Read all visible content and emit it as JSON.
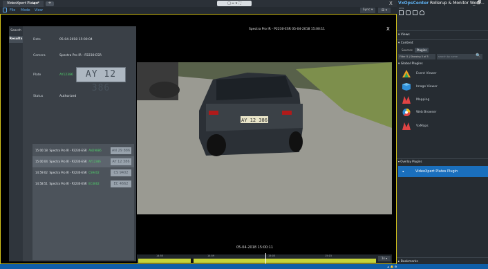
{
  "window": {
    "tab_label": "VideoXpert Plates*",
    "tab_close": "◀ x",
    "tab_add": "+",
    "center_controls": "□ ━ ∨ ⛶",
    "close": "X"
  },
  "menu": {
    "items": [
      "File",
      "Mode",
      "View"
    ],
    "sync_label": "Sync ▾",
    "layout_label": "⊞ ▾"
  },
  "left_tabs": {
    "search": "Search",
    "results": "Results"
  },
  "details": {
    "date_label": "Date",
    "date_value": "05-04-2018 15:00:04",
    "camera_label": "Camera",
    "camera_value": "Spectra Pro IR - P2230-ESR",
    "plate_label": "Plate",
    "plate_value": "AY12386",
    "plate_image_text": "AY 12 386",
    "status_label": "Status",
    "status_value": "Authorized"
  },
  "results": [
    {
      "time": "15:00:18",
      "camera": "Spectra Pro IR - P2230-ESR",
      "plate": "AN29886",
      "thumb": "AN 29 886"
    },
    {
      "time": "15:00:04",
      "camera": "Spectra Pro IR - P2230-ESR",
      "plate": "AY12386",
      "thumb": "AY 12 386"
    },
    {
      "time": "14:59:02",
      "camera": "Spectra Pro IR - P2230-ESR",
      "plate": "CS9402",
      "thumb": "CS 9402"
    },
    {
      "time": "14:58:51",
      "camera": "Spectra Pro IR - P2230-ESR",
      "plate": "EC4662",
      "thumb": "EC 4662"
    }
  ],
  "video": {
    "title": "Spectra Pro IR - P2230-ESR 05-04-2018 15:00:11",
    "close": "X",
    "timestamp": "05-04-2018 15:00:11",
    "car_plate": "AY 12 386",
    "timeline_labels": [
      "14:55",
      "14:59",
      "15:03",
      "15:15"
    ],
    "speed": "1x ▾"
  },
  "right_panel": {
    "title_brand": "VxOpsCenter",
    "title_rest": "Rollerup & Monitor Work...",
    "window_controls": "_ 🗗",
    "small_label": "vms",
    "views_label": "▾ Views",
    "content_label": "▾ Content",
    "subtabs": [
      "Sources",
      "Plugins"
    ],
    "filter_label": "Filter ⊻ | Showing 5 of 5",
    "search_placeholder": "search by name",
    "search_icon": "🔍",
    "plugins_header": "▾ Global Plugins",
    "plugins": [
      {
        "name": "Event Viewer",
        "icon": "event-viewer-icon",
        "color": "#f0a020"
      },
      {
        "name": "Image Viewer",
        "icon": "image-viewer-icon",
        "color": "#2f8fd8"
      },
      {
        "name": "Mapping",
        "icon": "mapping-icon",
        "color": "#e04444"
      },
      {
        "name": "Web Browser",
        "icon": "web-browser-icon",
        "color": "#2f8fd8"
      },
      {
        "name": "VxMaps",
        "icon": "vxmaps-icon",
        "color": "#e04444"
      }
    ],
    "overlay_header": "▾ Overlay Plugins",
    "selected_plugin": "VideoXpert Plates Plugin",
    "selected_plugin_icon": "⬩",
    "bookmarks_label": "▸ Bookmarks"
  },
  "taskbar": {
    "icons": "⏶ 🔔 ⚙"
  },
  "colors": {
    "accent_yellow": "#d7c51a",
    "accent_blue": "#1a6fbd",
    "plate_green": "#4fd06a"
  }
}
